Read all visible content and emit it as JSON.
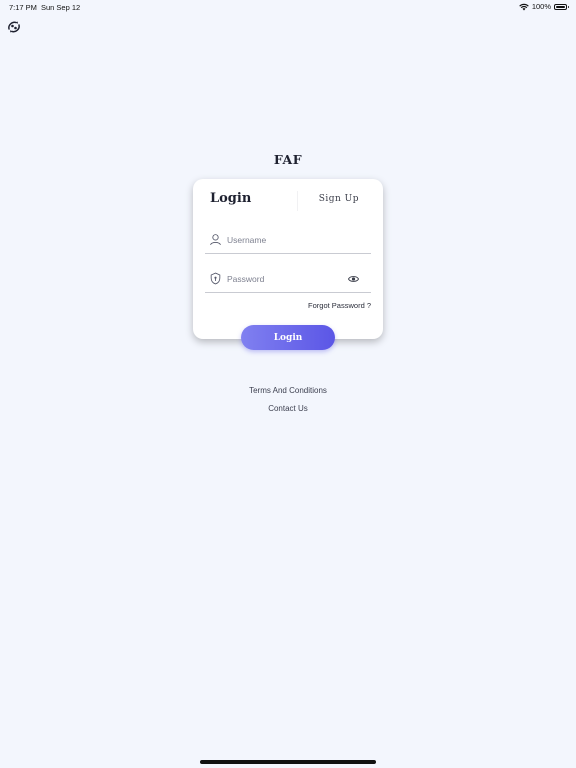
{
  "status_bar": {
    "time": "7:17 PM",
    "date": "Sun Sep 12",
    "battery": "100%"
  },
  "app": {
    "logo_icon": "swirl-logo-icon",
    "title": "FAF"
  },
  "auth_card": {
    "tabs": {
      "login": "Login",
      "signup": "Sign Up"
    },
    "username": {
      "icon": "user-icon",
      "value": "",
      "placeholder": "Username"
    },
    "password": {
      "icon": "shield-icon",
      "value": "",
      "placeholder": "Password",
      "toggle_icon": "eye-icon"
    },
    "forgot_password": "Forgot Password ?",
    "login_button": "Login"
  },
  "footer": {
    "terms": "Terms And Conditions",
    "contact": "Contact Us"
  },
  "colors": {
    "background": "#f3f6fd",
    "button_gradient_start": "#8080f0",
    "button_gradient_end": "#5b56e6",
    "card": "#ffffff"
  }
}
